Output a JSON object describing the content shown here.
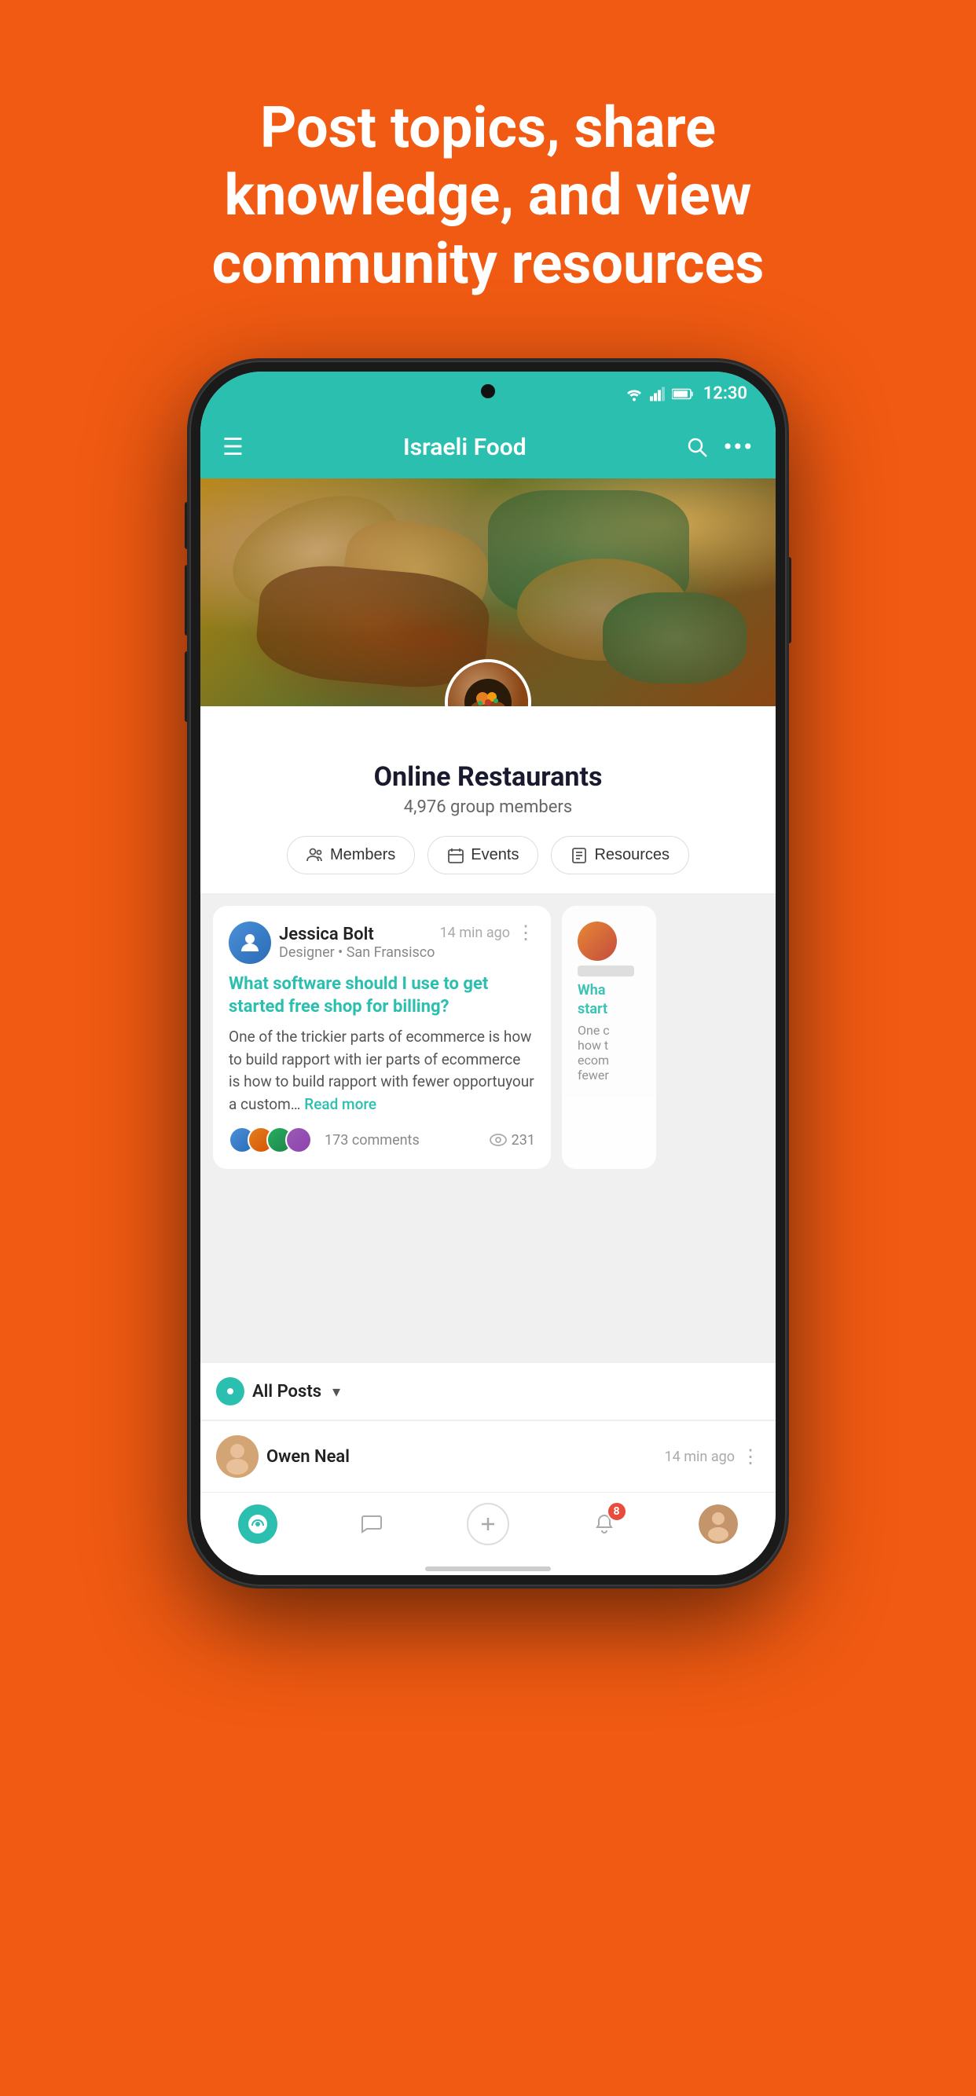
{
  "page": {
    "hero_text": "Post topics, share knowledge, and view community resources",
    "background_color": "#F05A12"
  },
  "status_bar": {
    "time": "12:30",
    "wifi_icon": "wifi",
    "signal_icon": "signal",
    "battery_icon": "battery"
  },
  "app_bar": {
    "title": "Israeli Food",
    "menu_icon": "☰",
    "search_icon": "🔍",
    "more_icon": "⋯"
  },
  "group": {
    "name": "Online Restaurants",
    "members_count": "4,976 group members"
  },
  "tabs": [
    {
      "label": "Members",
      "icon": "👥"
    },
    {
      "label": "Events",
      "icon": "📅"
    },
    {
      "label": "Resources",
      "icon": "📋"
    }
  ],
  "post_card": {
    "author_name": "Jessica Bolt",
    "author_title": "Designer • San Fransisco",
    "time": "14 min ago",
    "title": "What software should I use to get started free shop for billing?",
    "body": "One of the trickier parts of ecommerce is how to build rapport with ier parts of ecommerce is how to build rapport with fewer opportuyour a custom…",
    "read_more": "Read more",
    "comments_count": "173 comments",
    "views_count": "231",
    "more_icon": "⋮"
  },
  "filter": {
    "label": "All Posts",
    "arrow": "▾"
  },
  "recent_post": {
    "author_name": "Owen Neal",
    "time": "14 min ago",
    "more_icon": "⋮"
  },
  "bottom_nav": {
    "home_icon": "🏠",
    "chat_icon": "💬",
    "add_icon": "+",
    "notification_icon": "🔔",
    "notification_badge": "8",
    "profile_icon": "👤"
  }
}
